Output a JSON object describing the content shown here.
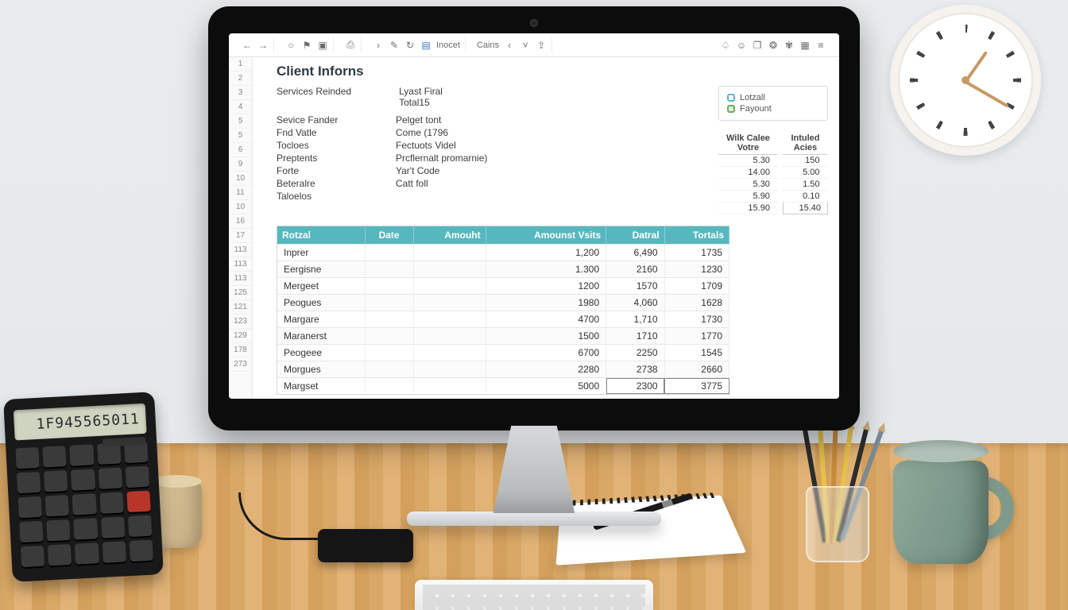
{
  "env": {
    "calculator_display": "1F945565011"
  },
  "toolbar": {
    "tab1": "Inocet",
    "tab2": "Cains"
  },
  "row_numbers": [
    "1",
    "2",
    "3",
    "4",
    "5",
    "5",
    "6",
    "9",
    "10",
    "11",
    "10",
    "16",
    "17",
    "113",
    "113",
    "113",
    "125",
    "121",
    "123",
    "129",
    "178",
    "273"
  ],
  "doc": {
    "title": "Client Inforns",
    "services_label": "Services Reinded",
    "services_sub1": "Lyast Firal",
    "services_sub2": "Total15",
    "info_rows": [
      [
        "Sevice Fander",
        "Pelget tont"
      ],
      [
        "Fnd Vatle",
        "Come (1796"
      ],
      [
        "Tocloes",
        "Fectuots Videl"
      ],
      [
        "Preptents",
        "Prcflernalt promarnie)"
      ],
      [
        "Forte",
        "Yar't Code"
      ],
      [
        "Beteralre",
        "Catt foll"
      ],
      [
        "Taloelos",
        ""
      ]
    ]
  },
  "legend": {
    "item1": "Lotzall",
    "item2": "Fayount"
  },
  "summary": {
    "head_a1": "Wilk Calee",
    "head_a2": "Votre",
    "head_b1": "Intuled",
    "head_b2": "Acies",
    "rows": [
      [
        "5.30",
        "150"
      ],
      [
        "14.00",
        "5.00"
      ],
      [
        "5.30",
        "1.50"
      ],
      [
        "5.90",
        "0.10"
      ]
    ],
    "totals": [
      "15.90",
      "15.40"
    ]
  },
  "table": {
    "headers": [
      "Rotzal",
      "Date",
      "Amouht",
      "Amounst Vsits",
      "Datral",
      "Tortals"
    ],
    "rows": [
      {
        "a": "Inprer",
        "b": "",
        "c": "",
        "d": "1,200",
        "e": "6,490",
        "f": "1735"
      },
      {
        "a": "Eergisne",
        "b": "",
        "c": "",
        "d": "1.300",
        "e": "2160",
        "f": "1230"
      },
      {
        "a": "Mergeet",
        "b": "",
        "c": "",
        "d": "1200",
        "e": "1570",
        "f": "1709"
      },
      {
        "a": "Peogues",
        "b": "",
        "c": "",
        "d": "1980",
        "e": "4,060",
        "f": "1628"
      },
      {
        "a": "Margare",
        "b": "",
        "c": "",
        "d": "4700",
        "e": "1,710",
        "f": "1730"
      },
      {
        "a": "Maranerst",
        "b": "",
        "c": "",
        "d": "1500",
        "e": "1710",
        "f": "1770"
      },
      {
        "a": "Peogeee",
        "b": "",
        "c": "",
        "d": "6700",
        "e": "2250",
        "f": "1545"
      },
      {
        "a": "Morgues",
        "b": "",
        "c": "",
        "d": "2280",
        "e": "2738",
        "f": "2660"
      },
      {
        "a": "Margset",
        "b": "",
        "c": "",
        "d": "5000",
        "e": "2300",
        "f": "3775",
        "boxed": true
      }
    ]
  }
}
